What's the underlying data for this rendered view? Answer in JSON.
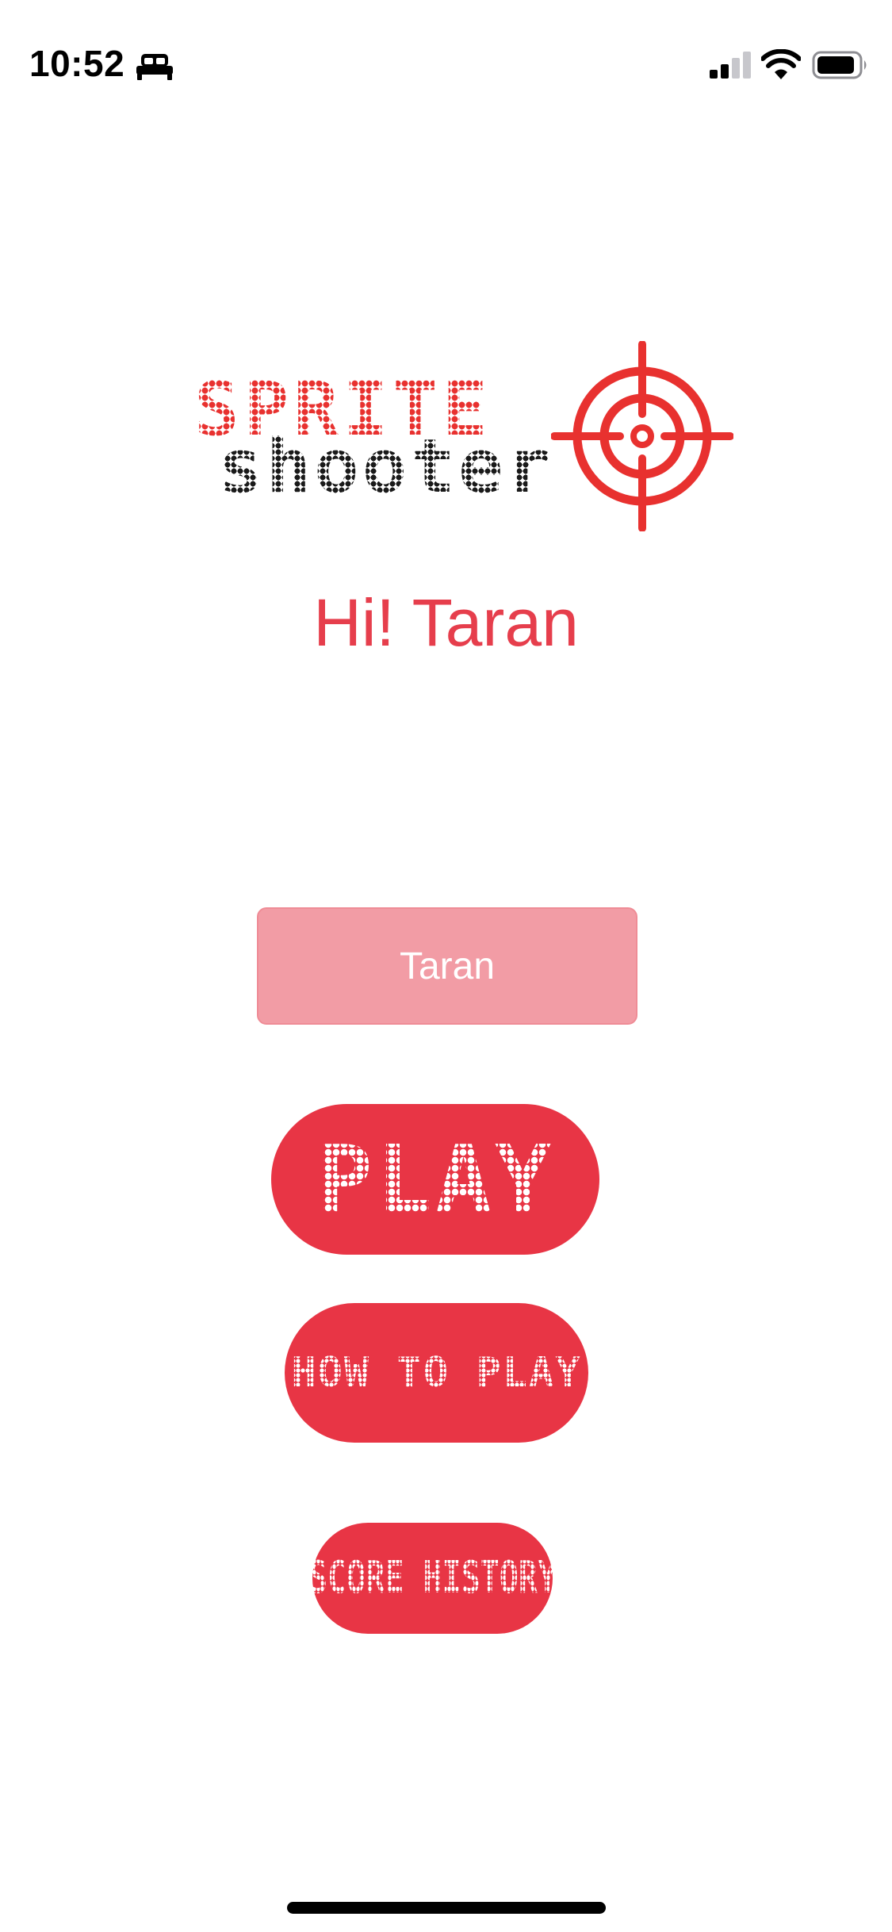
{
  "status_bar": {
    "time": "10:52",
    "icons": [
      "bed-icon",
      "cellular-signal-icon",
      "wifi-icon",
      "battery-icon"
    ]
  },
  "logo": {
    "line1": "SPRITE",
    "line2": "shooter",
    "icon": "crosshair-icon"
  },
  "greeting": "Hi! Taran",
  "name_field": {
    "value": "Taran"
  },
  "buttons": {
    "play": "PLAY",
    "how_to_play": "HOW TO PLAY",
    "score_history": "SCORE HISTORY"
  },
  "colors": {
    "accent": "#e83545",
    "greeting_text": "#e63e4c",
    "field_background": "#f29ca5",
    "logo_red": "#e8312f",
    "logo_black": "#1a1a1a"
  }
}
